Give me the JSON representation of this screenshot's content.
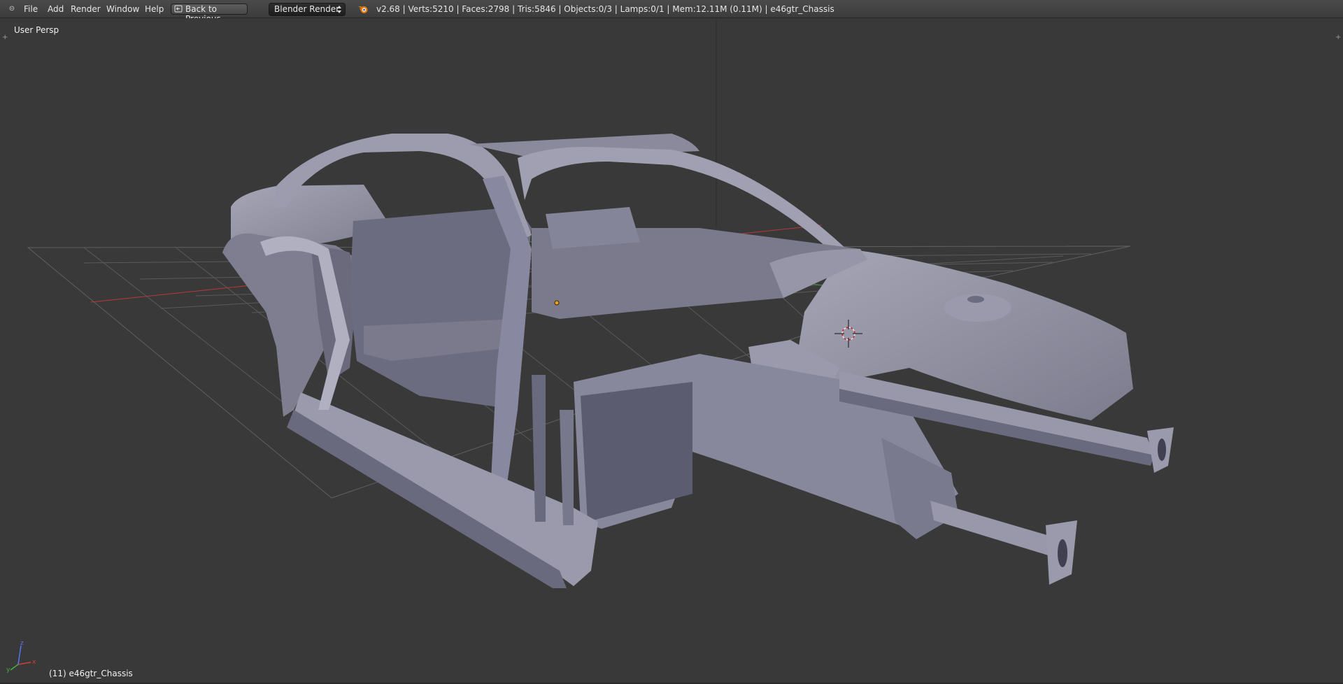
{
  "header": {
    "editor_type_icon": "editor-type-icon",
    "menus": [
      {
        "label": "File"
      },
      {
        "label": "Add"
      },
      {
        "label": "Render"
      },
      {
        "label": "Window"
      },
      {
        "label": "Help"
      }
    ],
    "back_button_label": "Back to Previous",
    "render_engine": "Blender Render",
    "stats": "v2.68 | Verts:5210 | Faces:2798 | Tris:5846 | Objects:0/3 | Lamps:0/1 | Mem:12.11M (0.11M) | e46gtr_Chassis"
  },
  "viewport": {
    "view_name": "User Persp",
    "active_object": "(11) e46gtr_Chassis",
    "axes": {
      "x": "x",
      "y": "y",
      "z": "z"
    }
  },
  "colors": {
    "background": "#393939",
    "header": "#444444",
    "mesh": "#8a8a9c",
    "grid": "#5a5a5a",
    "x_axis": "#b53a3a",
    "y_axis": "#3f9a3f",
    "z_axis": "#4a6ad0"
  }
}
